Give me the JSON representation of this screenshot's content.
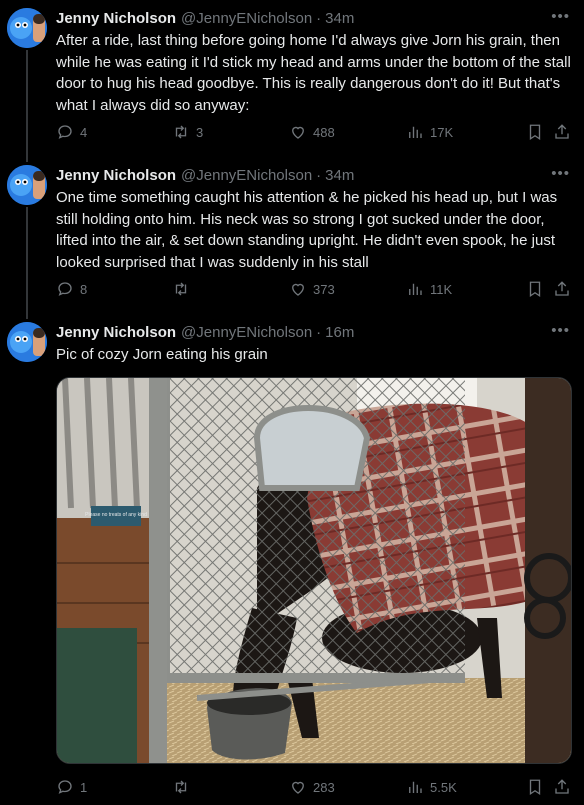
{
  "tweets": [
    {
      "name": "Jenny Nicholson",
      "handle": "@JennyENicholson",
      "sep": "·",
      "time": "34m",
      "text": "After a ride, last thing before going home I'd always give Jorn his grain, then while he was eating it I'd stick my head and arms under the bottom of the stall door to hug his head goodbye. This is really dangerous don't do it! But that's what I always did so anyway:",
      "replies": "4",
      "reposts": "3",
      "likes": "488",
      "views": "17K"
    },
    {
      "name": "Jenny Nicholson",
      "handle": "@JennyENicholson",
      "sep": "·",
      "time": "34m",
      "text": "One time something caught his attention & he picked his head up, but I was still holding onto him. His neck was so strong I got sucked under the door, lifted into the air, & set down standing upright. He didn't even spook, he just looked surprised that I was suddenly in his stall",
      "replies": "8",
      "reposts": "",
      "likes": "373",
      "views": "11K"
    },
    {
      "name": "Jenny Nicholson",
      "handle": "@JennyENicholson",
      "sep": "·",
      "time": "16m",
      "text": "Pic of cozy Jorn eating his grain",
      "replies": "1",
      "reposts": "",
      "likes": "283",
      "views": "5.5K"
    }
  ],
  "photo": {
    "sign_text": "Please no treats of any kind"
  },
  "colors": {
    "background": "#000000",
    "text": "#e7e9ea",
    "muted": "#71767b",
    "divider": "#2f3336"
  },
  "icons": [
    "avatar",
    "more-icon",
    "reply-icon",
    "repost-icon",
    "like-icon",
    "views-icon",
    "bookmark-icon",
    "share-icon"
  ]
}
